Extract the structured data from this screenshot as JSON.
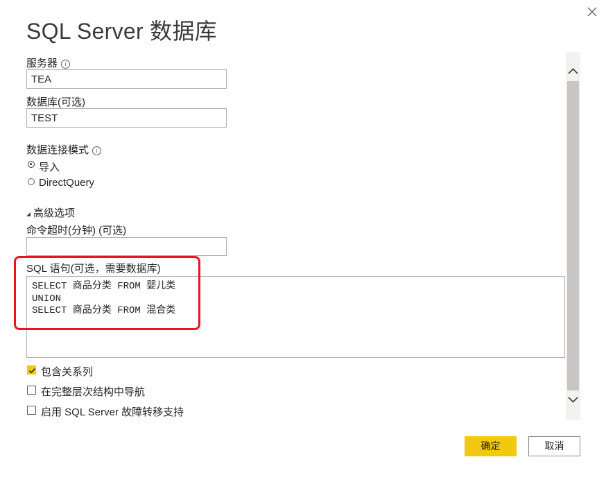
{
  "dialog": {
    "title": "SQL Server 数据库"
  },
  "server": {
    "label": "服务器",
    "value": "TEA"
  },
  "database": {
    "label": "数据库(可选)",
    "value": "TEST"
  },
  "connectivity_mode": {
    "label": "数据连接模式",
    "options": [
      {
        "label": "导入",
        "selected": true
      },
      {
        "label": "DirectQuery",
        "selected": false
      }
    ]
  },
  "advanced": {
    "toggle_label": "高级选项",
    "timeout_label": "命令超时(分钟) (可选)",
    "timeout_value": "",
    "sql_label": "SQL 语句(可选，需要数据库)",
    "sql_lines": [
      "SELECT 商品分类 FROM 婴儿类",
      "UNION",
      "SELECT 商品分类 FROM 混合类"
    ]
  },
  "options": {
    "include_relationships": {
      "label": "包含关系列",
      "checked": true
    },
    "navigate_full_hierarchy": {
      "label": "在完整层次结构中导航",
      "checked": false
    },
    "enable_failover": {
      "label": "启用 SQL Server 故障转移支持",
      "checked": false
    }
  },
  "buttons": {
    "ok": "确定",
    "cancel": "取消"
  },
  "colors": {
    "accent": "#f2c811",
    "highlight": "#e8141e"
  }
}
